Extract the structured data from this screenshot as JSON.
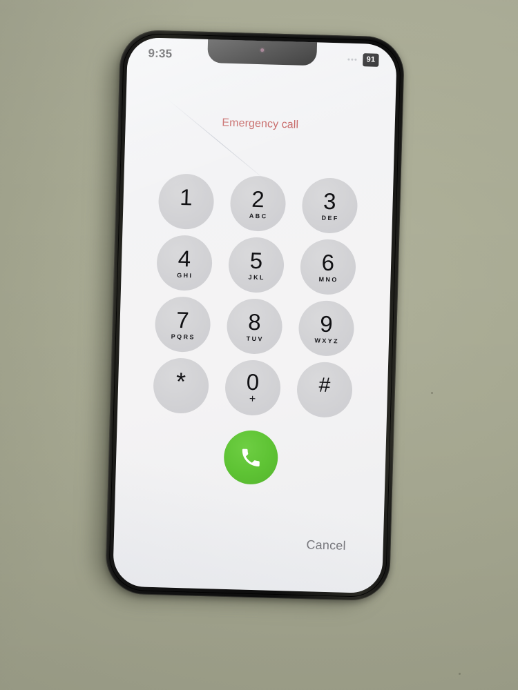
{
  "device": {
    "type": "smartphone",
    "bezel_color": "#101010",
    "screen_background": "#f3f3f5",
    "surface_color": "#a9ab94"
  },
  "status_bar": {
    "time": "9:35",
    "signal_icon": "signal-dots-icon",
    "battery_level": "91",
    "battery_icon": "battery-badge-icon"
  },
  "screen": {
    "emergency_label": "Emergency call"
  },
  "keypad": {
    "keys": [
      {
        "digit": "1",
        "letters": "",
        "name": "key-1"
      },
      {
        "digit": "2",
        "letters": "ABC",
        "name": "key-2"
      },
      {
        "digit": "3",
        "letters": "DEF",
        "name": "key-3"
      },
      {
        "digit": "4",
        "letters": "GHI",
        "name": "key-4"
      },
      {
        "digit": "5",
        "letters": "JKL",
        "name": "key-5"
      },
      {
        "digit": "6",
        "letters": "MNO",
        "name": "key-6"
      },
      {
        "digit": "7",
        "letters": "PQRS",
        "name": "key-7"
      },
      {
        "digit": "8",
        "letters": "TUV",
        "name": "key-8"
      },
      {
        "digit": "9",
        "letters": "WXYZ",
        "name": "key-9"
      },
      {
        "digit": "*",
        "letters": "",
        "name": "key-star"
      },
      {
        "digit": "0",
        "letters": "+",
        "name": "key-0"
      },
      {
        "digit": "#",
        "letters": "",
        "name": "key-hash"
      }
    ]
  },
  "call_button": {
    "icon": "phone-handset-icon",
    "color": "#5ec334"
  },
  "actions": {
    "cancel_label": "Cancel"
  }
}
